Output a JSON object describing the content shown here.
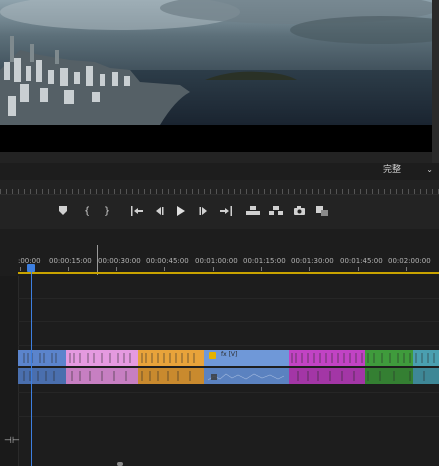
{
  "monitor": {
    "quality_label": "完整",
    "quality_icon": "chevron-down-icon"
  },
  "transport": {
    "buttons": [
      {
        "name": "add-marker-button",
        "icon": "marker-icon"
      },
      {
        "name": "mark-in-button",
        "glyph": "{"
      },
      {
        "name": "mark-out-button",
        "glyph": "}"
      },
      {
        "name": "go-to-in-button",
        "icon": "go-to-in-icon"
      },
      {
        "name": "step-back-button",
        "icon": "step-back-icon"
      },
      {
        "name": "play-button",
        "icon": "play-icon"
      },
      {
        "name": "step-forward-button",
        "icon": "step-forward-icon"
      },
      {
        "name": "go-to-out-button",
        "icon": "go-to-out-icon"
      },
      {
        "name": "lift-button",
        "icon": "lift-icon"
      },
      {
        "name": "extract-button",
        "icon": "extract-icon"
      },
      {
        "name": "export-frame-button",
        "icon": "camera-icon"
      },
      {
        "name": "comparison-view-button",
        "icon": "comparison-icon"
      }
    ]
  },
  "timeline": {
    "timecodes": [
      ":00:00",
      "00:00:15:00",
      "00:00:30:00",
      "00:00:45:00",
      "00:01:00:00",
      "00:01:15:00",
      "00:01:30:00",
      "00:01:45:00",
      "00:02:00:00"
    ],
    "clips": {
      "video_label": "fx [V]"
    },
    "colors": {
      "accent_blue": "#3d7fe0",
      "work_area": "#c8a300",
      "clip_pink": "#e59ae0",
      "clip_orange": "#e8a33a",
      "clip_blue": "#6f98d8",
      "clip_magenta": "#c143c4",
      "clip_green": "#3f9b3c",
      "clip_teal": "#4a9fb0"
    }
  }
}
